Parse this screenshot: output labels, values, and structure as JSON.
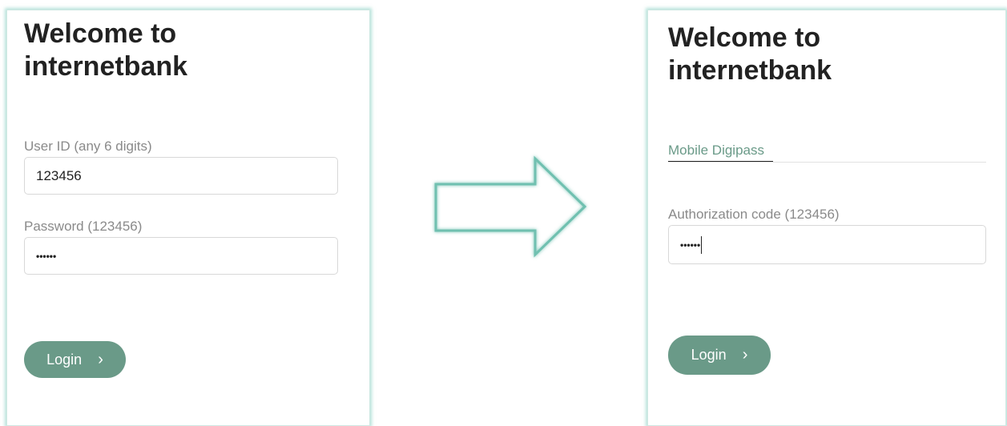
{
  "login_screen": {
    "title_line1": "Welcome to",
    "title_line2": "internetbank",
    "user_id_label": "User ID (any 6 digits)",
    "user_id_value": "123456",
    "password_label": "Password (123456)",
    "password_value": "••••••",
    "login_label": "Login",
    "login_chevron": "›"
  },
  "auth_screen": {
    "title_line1": "Welcome to",
    "title_line2": "internetbank",
    "tab_label": "Mobile Digipass",
    "auth_label": "Authorization code (123456)",
    "auth_value": "••••••",
    "login_label": "Login",
    "login_chevron": "›"
  },
  "colors": {
    "accent": "#6a9a88",
    "panel_glow": "#78c8b9",
    "arrow_stroke": "#6fc0b0"
  },
  "icons": {
    "transition": "right-arrow-icon",
    "button": "chevron-right-icon"
  }
}
